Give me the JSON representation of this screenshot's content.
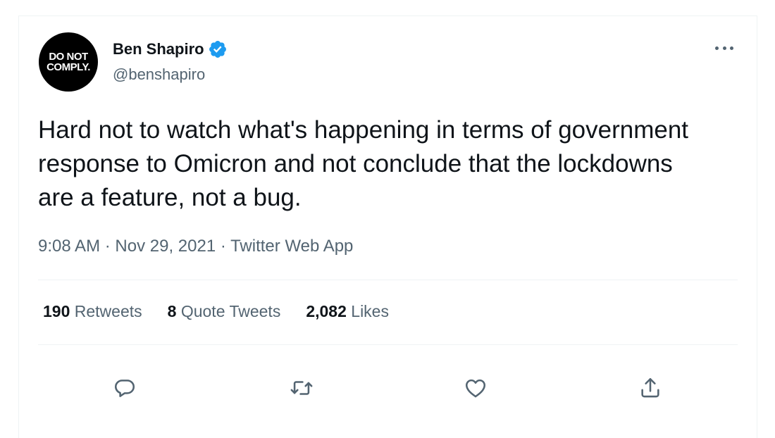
{
  "author": {
    "display_name": "Ben Shapiro",
    "handle": "@benshapiro",
    "avatar_text_line1": "DO NOT",
    "avatar_text_line2": "COMPLY.",
    "verified": true
  },
  "tweet": {
    "text": "Hard not to watch what's happening in terms of government response to Omicron and not conclude that the lockdowns are a feature, not a bug.",
    "time": "9:08 AM",
    "date": "Nov 29, 2021",
    "source": "Twitter Web App",
    "separator": "·"
  },
  "stats": {
    "retweets_count": "190",
    "retweets_label": "Retweets",
    "quote_count": "8",
    "quote_label": "Quote Tweets",
    "likes_count": "2,082",
    "likes_label": "Likes"
  },
  "actions": [
    "reply-icon",
    "retweet-icon",
    "like-icon",
    "share-icon"
  ],
  "colors": {
    "text_primary": "#0f1419",
    "text_secondary": "#536471",
    "verified_blue": "#1d9bf0",
    "divider": "#eff3f4"
  }
}
